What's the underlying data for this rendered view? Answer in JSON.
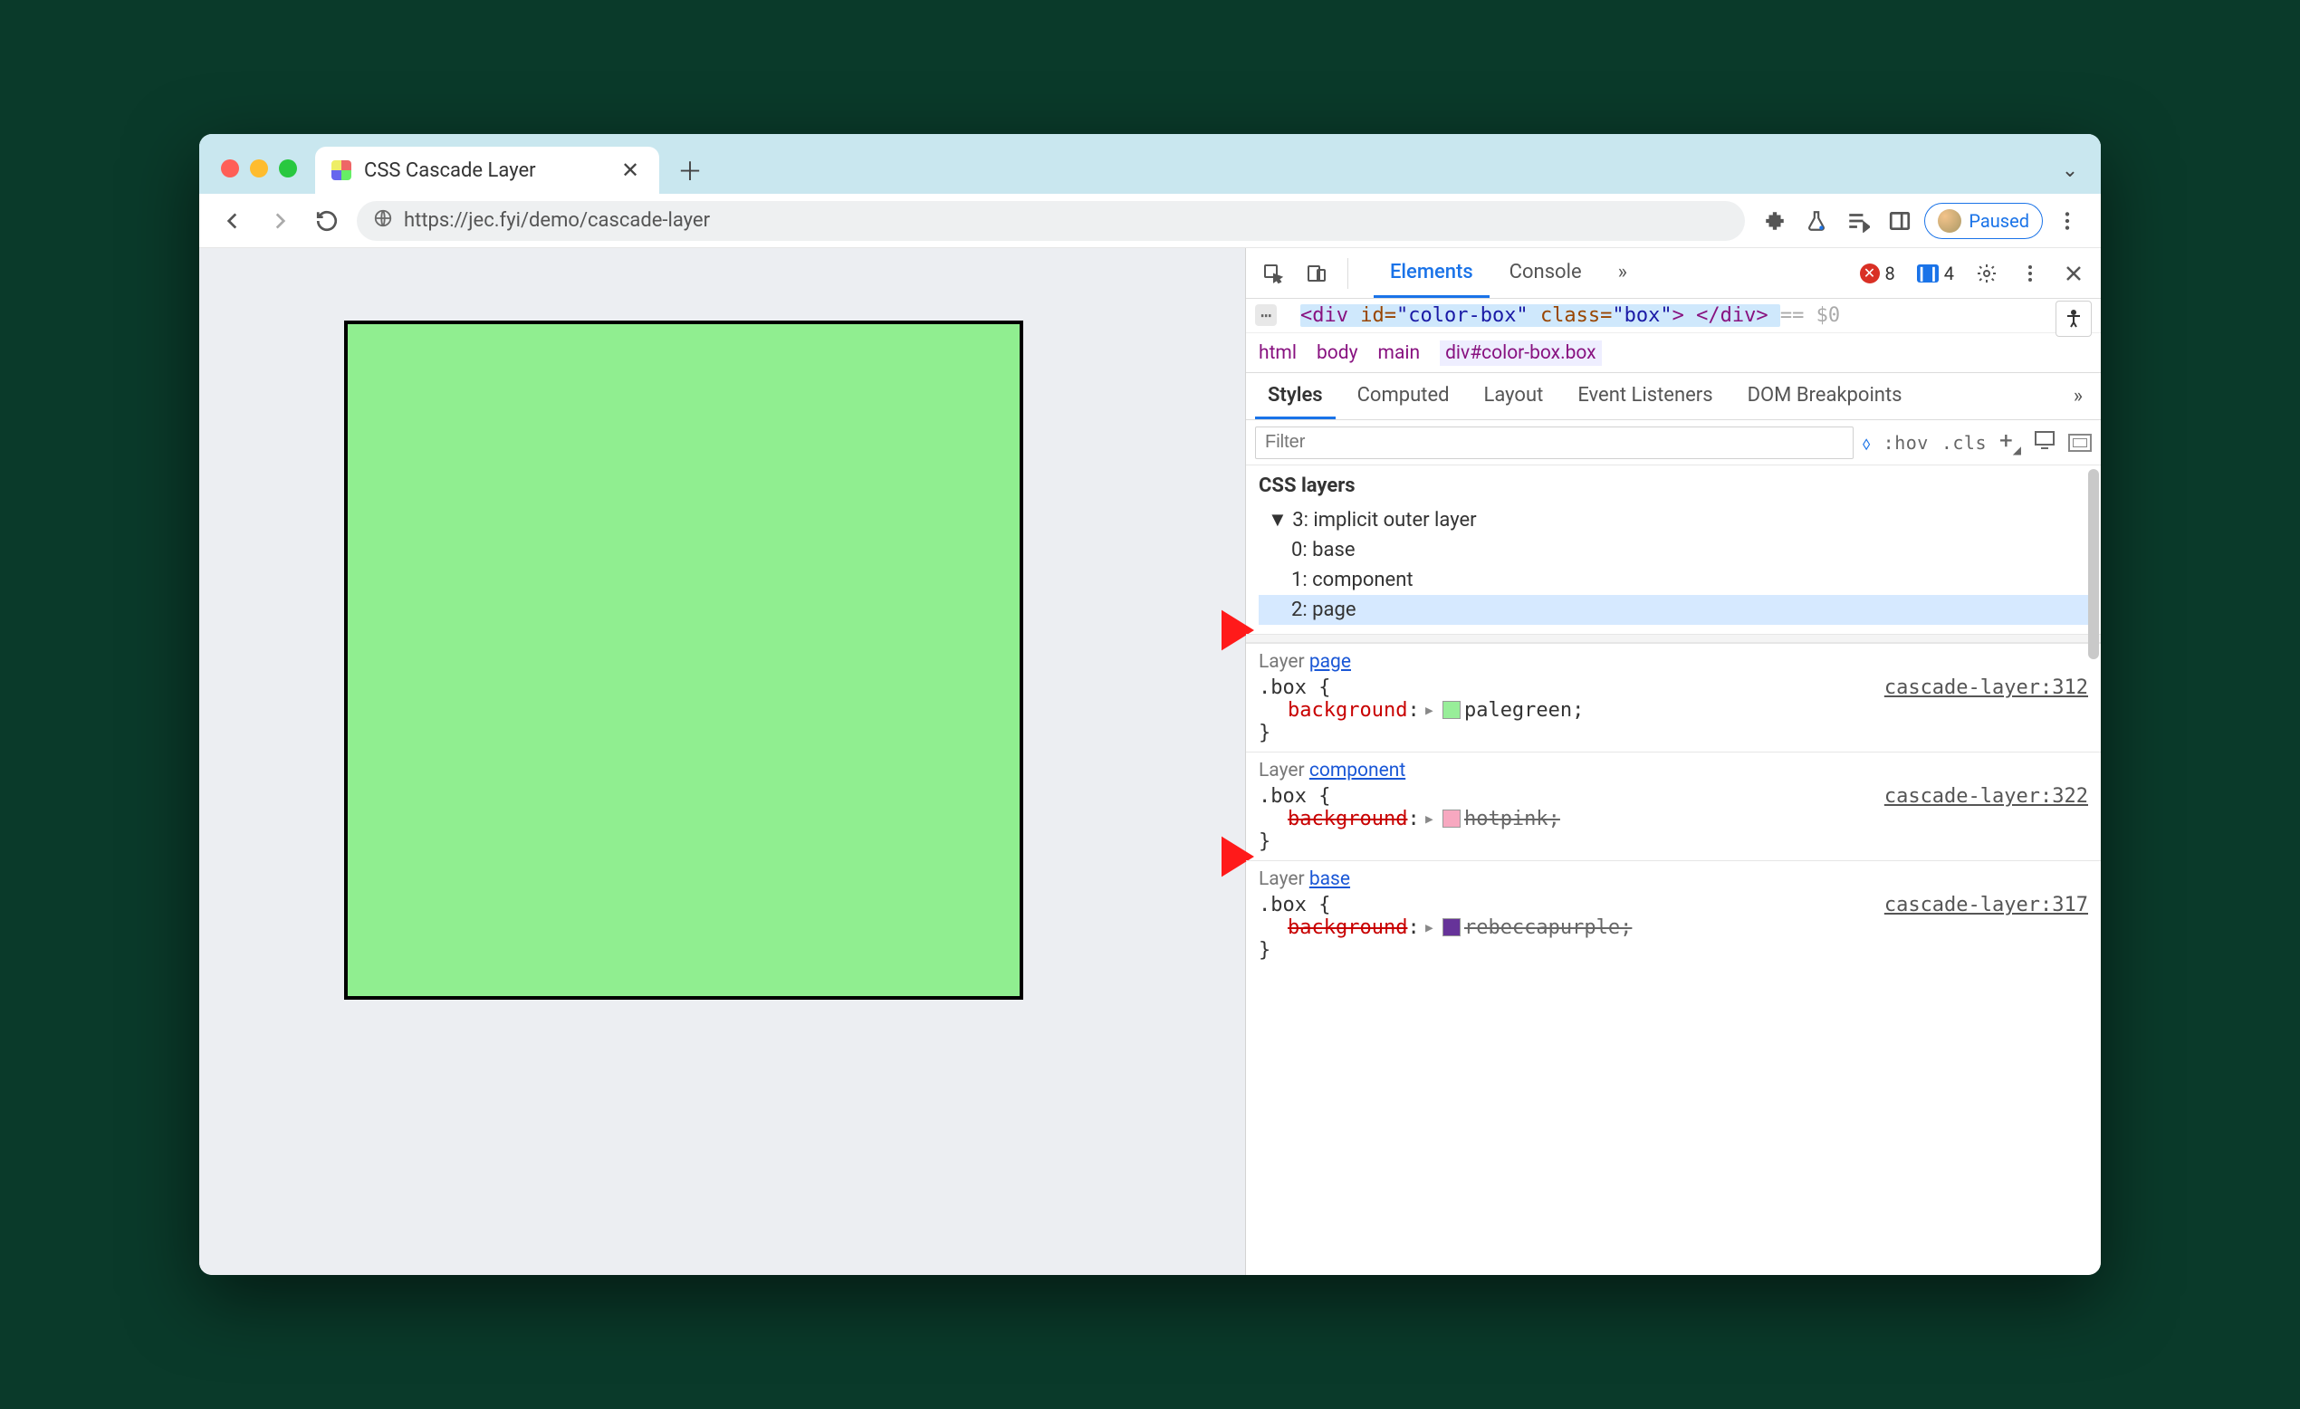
{
  "tab": {
    "title": "CSS Cascade Layer"
  },
  "url": "https://jec.fyi/demo/cascade-layer",
  "paused_chip": "Paused",
  "devtools": {
    "tabs": [
      "Elements",
      "Console"
    ],
    "active_tab": "Elements",
    "errors": "8",
    "issues": "4",
    "html_line": {
      "open": "<div",
      "id_attr": "id",
      "id_val": "\"color-box\"",
      "class_attr": "class",
      "class_val": "\"box\"",
      "close": "> </div>",
      "suffix": "== $0"
    },
    "breadcrumbs": [
      "html",
      "body",
      "main",
      "div#color-box.box"
    ],
    "styles_tabs": [
      "Styles",
      "Computed",
      "Layout",
      "Event Listeners",
      "DOM Breakpoints"
    ],
    "filter_placeholder": "Filter",
    "filter_hov": ":hov",
    "filter_cls": ".cls",
    "css_layers_title": "CSS layers",
    "layer_tree": {
      "root": "3: implicit outer layer",
      "children": [
        "0: base",
        "1: component",
        "2: page"
      ],
      "selected_index": 2
    },
    "rules": [
      {
        "layer_label": "Layer ",
        "layer_link": "page",
        "selector": ".box {",
        "source": "cascade-layer:312",
        "prop": "background",
        "swatch": "#98ee99",
        "value": "palegreen;",
        "overridden": false
      },
      {
        "layer_label": "Layer ",
        "layer_link": "component",
        "selector": ".box {",
        "source": "cascade-layer:322",
        "prop": "background",
        "swatch": "#f7a8c0",
        "value": "hotpink;",
        "overridden": true
      },
      {
        "layer_label": "Layer ",
        "layer_link": "base",
        "selector": ".box {",
        "source": "cascade-layer:317",
        "prop": "background",
        "swatch": "#663399",
        "value": "rebeccapurple;",
        "overridden": true
      }
    ]
  },
  "demo_box_color": "#90ee90"
}
